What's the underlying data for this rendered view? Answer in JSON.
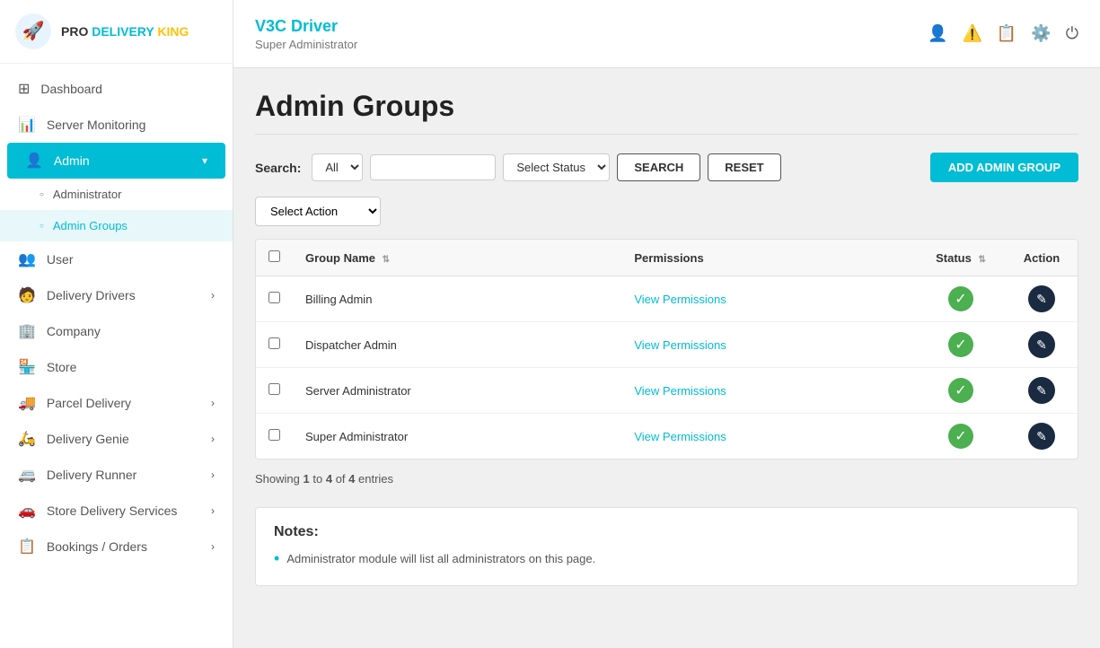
{
  "logo": {
    "pro": "PRO",
    "delivery": "DELIVERY",
    "king": "KING"
  },
  "header": {
    "title": "V3C Driver",
    "subtitle": "Super Administrator"
  },
  "sidebar": {
    "items": [
      {
        "id": "dashboard",
        "label": "Dashboard",
        "icon": "⊞",
        "active": false
      },
      {
        "id": "server-monitoring",
        "label": "Server Monitoring",
        "icon": "📊",
        "active": false
      },
      {
        "id": "admin",
        "label": "Admin",
        "icon": "👤",
        "active": true,
        "expanded": true
      },
      {
        "id": "administrator",
        "label": "Administrator",
        "icon": "○",
        "active": false,
        "sub": true
      },
      {
        "id": "admin-groups",
        "label": "Admin Groups",
        "icon": "○",
        "active": true,
        "sub": true
      },
      {
        "id": "user",
        "label": "User",
        "icon": "👥",
        "active": false
      },
      {
        "id": "delivery-drivers",
        "label": "Delivery Drivers",
        "icon": "🧑",
        "active": false,
        "hasArrow": true
      },
      {
        "id": "company",
        "label": "Company",
        "icon": "🏢",
        "active": false
      },
      {
        "id": "store",
        "label": "Store",
        "icon": "🏪",
        "active": false
      },
      {
        "id": "parcel-delivery",
        "label": "Parcel Delivery",
        "icon": "🚚",
        "active": false,
        "hasArrow": true
      },
      {
        "id": "delivery-genie",
        "label": "Delivery Genie",
        "icon": "🛵",
        "active": false,
        "hasArrow": true
      },
      {
        "id": "delivery-runner",
        "label": "Delivery Runner",
        "icon": "🚐",
        "active": false,
        "hasArrow": true
      },
      {
        "id": "store-delivery-services",
        "label": "Store Delivery Services",
        "icon": "🚗",
        "active": false,
        "hasArrow": true
      },
      {
        "id": "bookings-orders",
        "label": "Bookings / Orders",
        "icon": "📋",
        "active": false,
        "hasArrow": true
      }
    ]
  },
  "page": {
    "title": "Admin Groups"
  },
  "search": {
    "label": "Search:",
    "all_option": "All",
    "status_placeholder": "Select Status",
    "search_btn": "SEARCH",
    "reset_btn": "RESET",
    "add_btn": "ADD ADMIN GROUP"
  },
  "bulk_action": {
    "placeholder": "Select Action"
  },
  "table": {
    "columns": [
      {
        "id": "group-name",
        "label": "Group Name",
        "sortable": true
      },
      {
        "id": "permissions",
        "label": "Permissions"
      },
      {
        "id": "status",
        "label": "Status",
        "sortable": true
      },
      {
        "id": "action",
        "label": "Action"
      }
    ],
    "rows": [
      {
        "id": 1,
        "group_name": "Billing Admin",
        "permissions_label": "View Permissions",
        "status": "active"
      },
      {
        "id": 2,
        "group_name": "Dispatcher Admin",
        "permissions_label": "View Permissions",
        "status": "active"
      },
      {
        "id": 3,
        "group_name": "Server Administrator",
        "permissions_label": "View Permissions",
        "status": "active"
      },
      {
        "id": 4,
        "group_name": "Super Administrator",
        "permissions_label": "View Permissions",
        "status": "active"
      }
    ]
  },
  "pagination": {
    "showing": "Showing",
    "from": "1",
    "to": "4",
    "of": "of",
    "total": "4",
    "entries": "entries"
  },
  "notes": {
    "title": "Notes:",
    "items": [
      "Administrator module will list all administrators on this page."
    ]
  }
}
